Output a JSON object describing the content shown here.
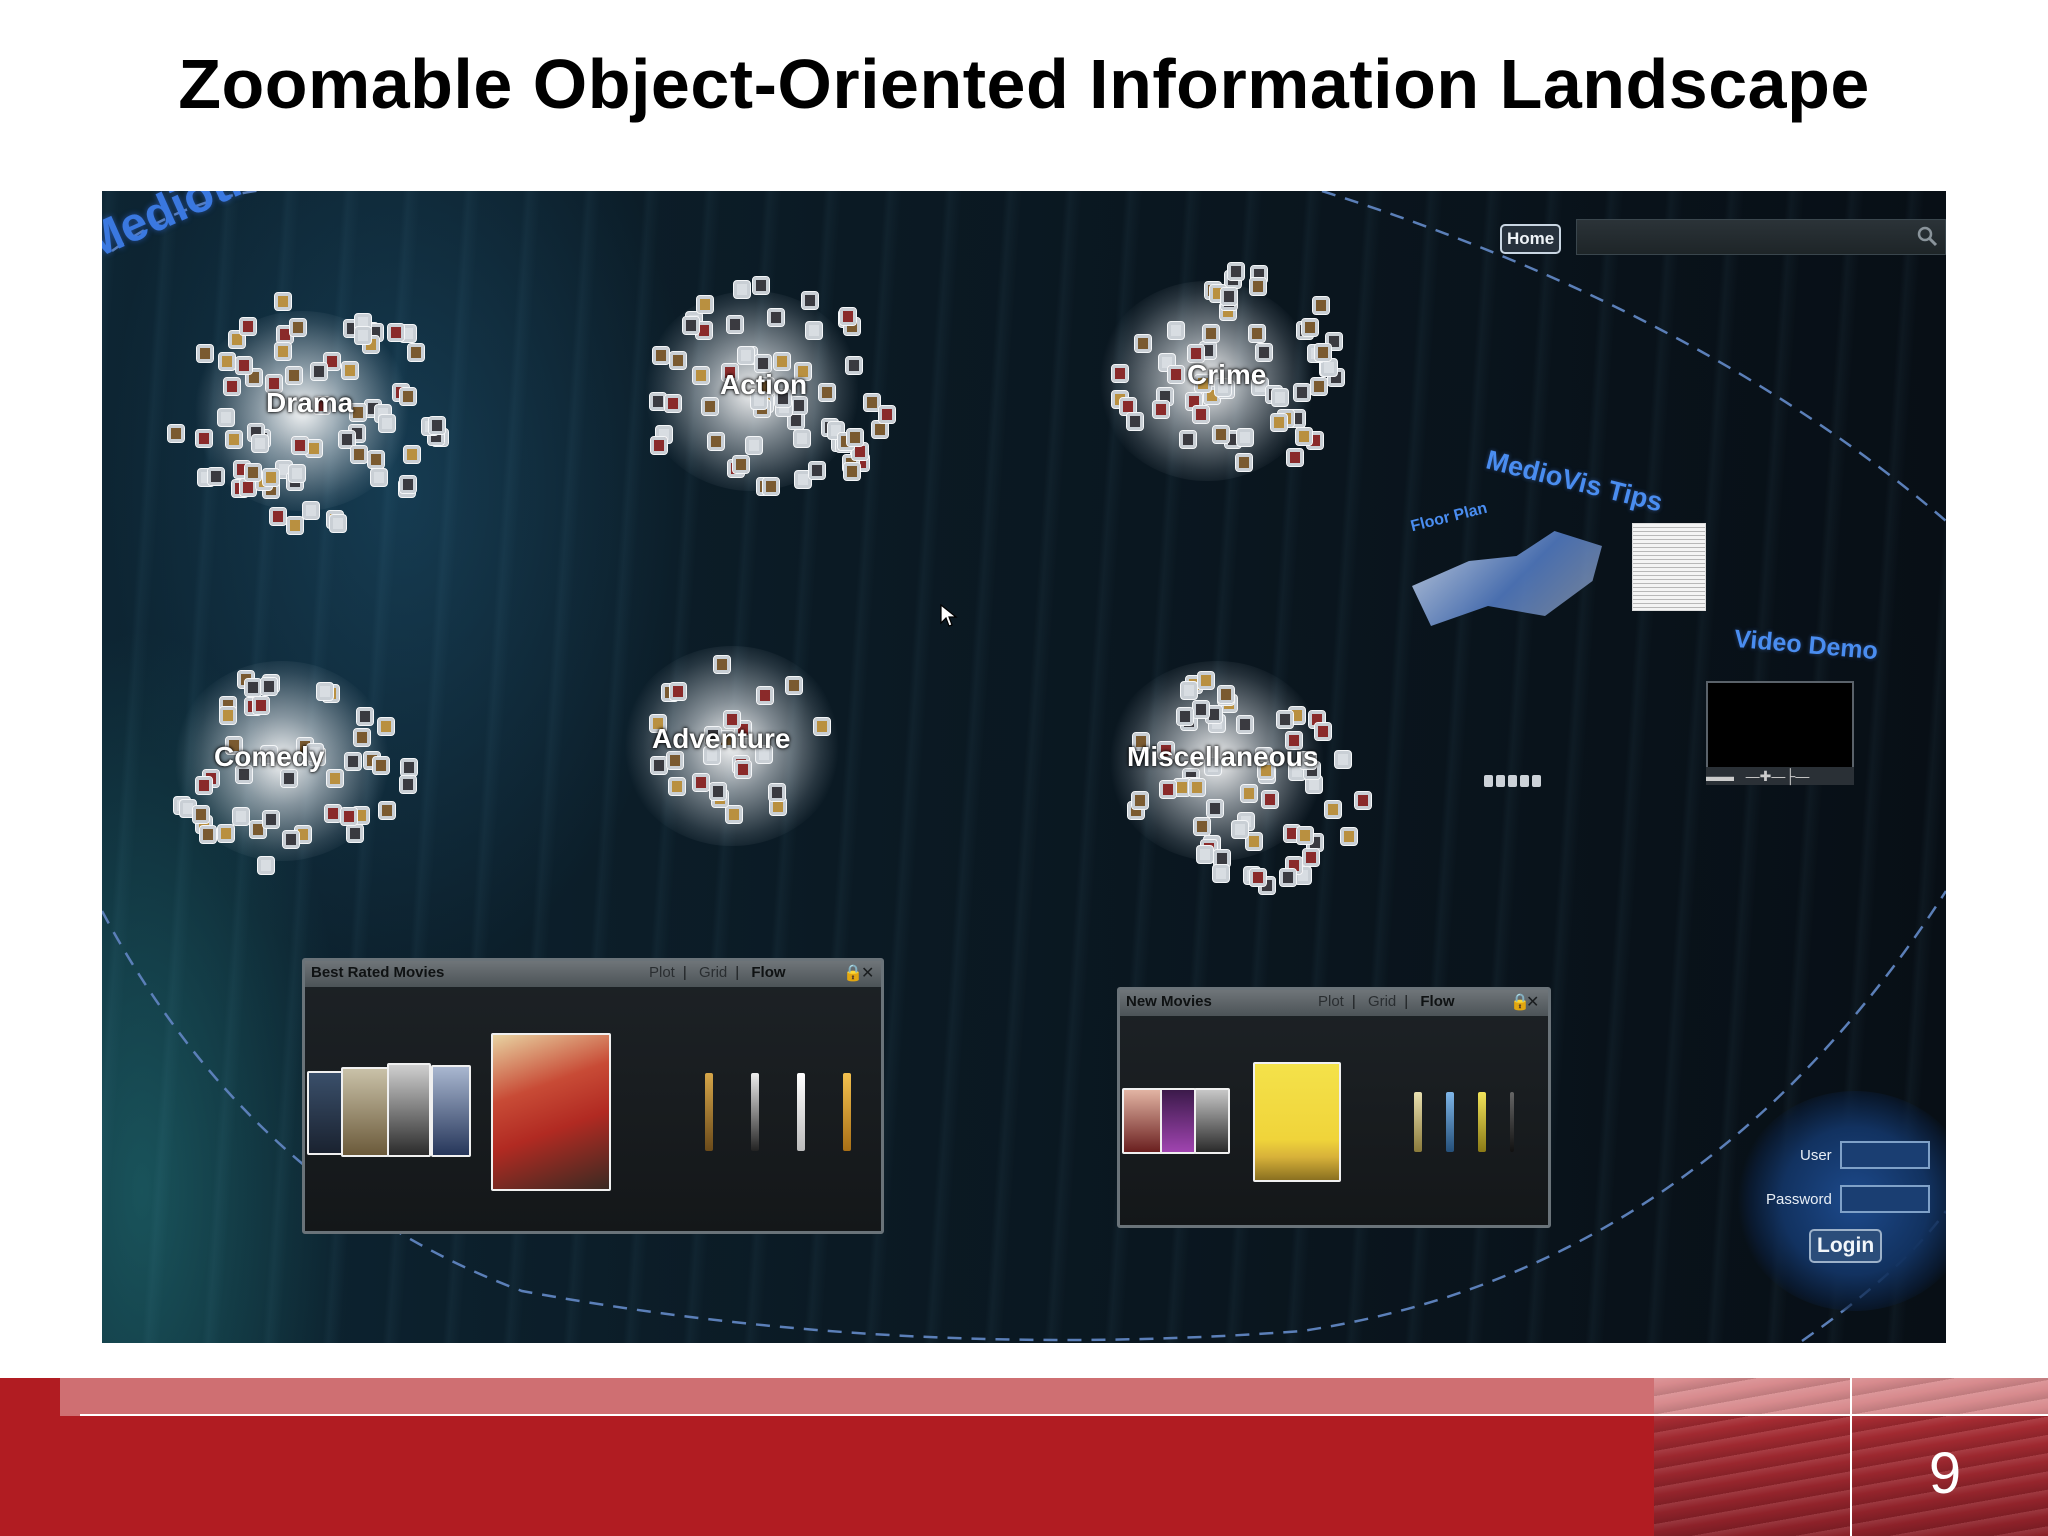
{
  "slide": {
    "title": "Zoomable Object-Oriented Information Landscape",
    "page_number": "9"
  },
  "app": {
    "brand": "Mediothek",
    "home_button": "Home",
    "clusters": [
      {
        "label": "Drama"
      },
      {
        "label": "Action"
      },
      {
        "label": "Crime"
      },
      {
        "label": "Comedy"
      },
      {
        "label": "Adventure"
      },
      {
        "label": "Miscellaneous"
      }
    ],
    "tips_title": "MedioVis Tips",
    "floor_plan_label": "Floor Plan",
    "video_title": "Video Demo",
    "panels": {
      "best_rated": {
        "title": "Best Rated Movies",
        "views": [
          "Plot",
          "Grid",
          "Flow"
        ],
        "selected_view": "Flow"
      },
      "new_movies": {
        "title": "New Movies",
        "views": [
          "Plot",
          "Grid",
          "Flow"
        ],
        "selected_view": "Flow"
      }
    },
    "login": {
      "user_label": "User",
      "password_label": "Password",
      "button": "Login",
      "user_value": "",
      "password_value": ""
    }
  },
  "icons": [
    "search-icon",
    "lock-icon",
    "close-icon",
    "cursor-icon"
  ],
  "colors": {
    "accent_blue": "#3a78e0",
    "footer_red": "#b11c22",
    "app_background": "#0b1a24"
  }
}
